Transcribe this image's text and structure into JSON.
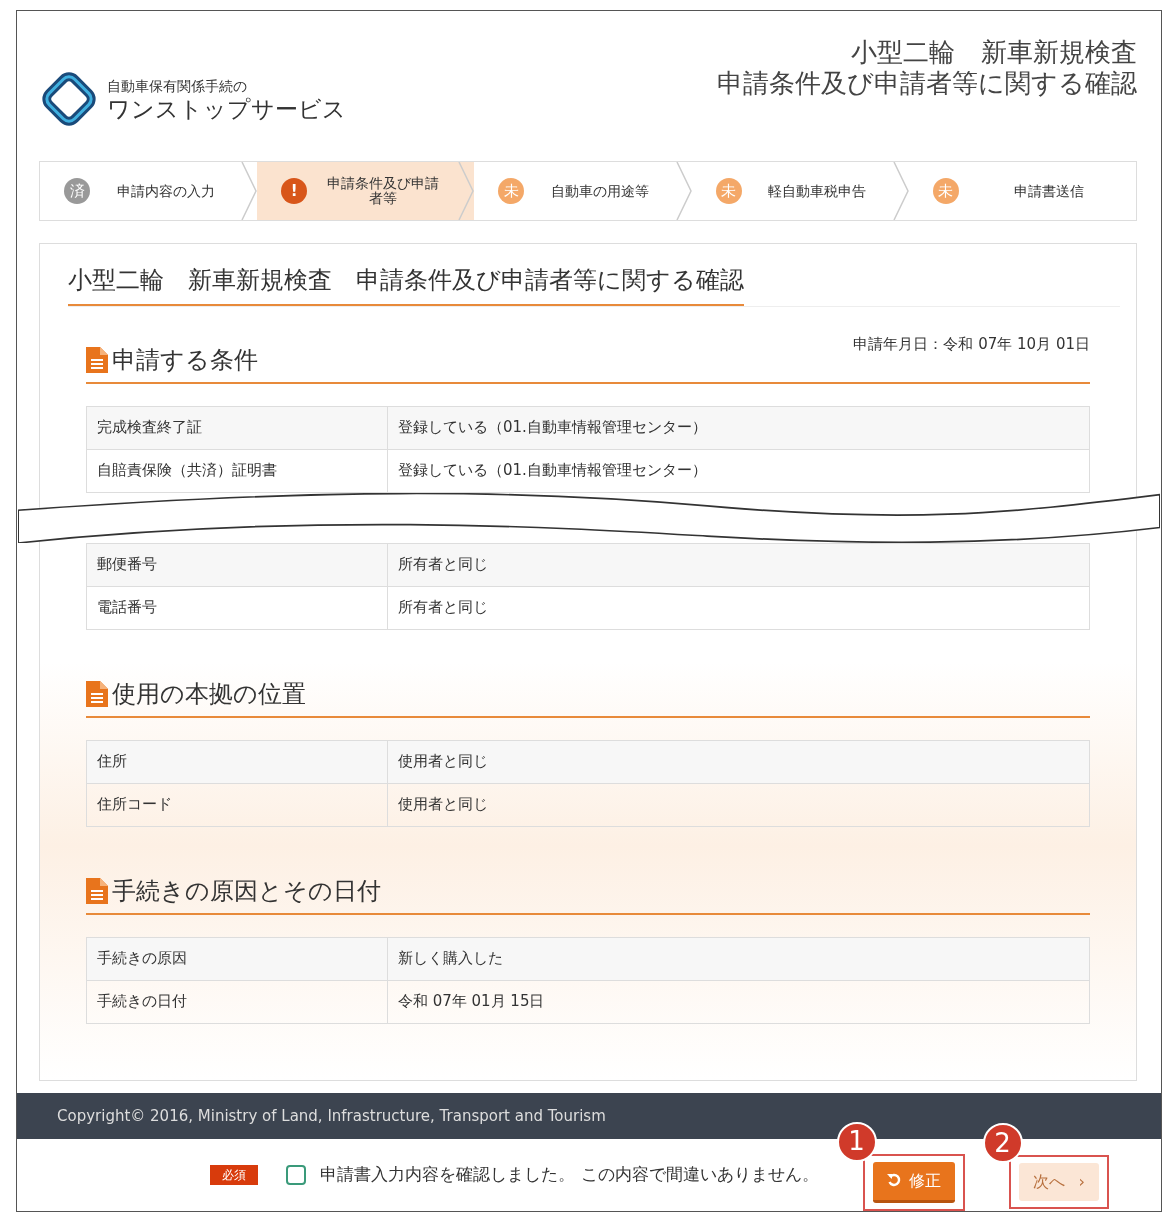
{
  "header": {
    "logo_subtitle": "自動車保有関係手続の",
    "logo_title": "ワンストップサービス",
    "page_title_lines": [
      "小型二輪　新車新規検査",
      "申請条件及び申請者等に関する確認"
    ]
  },
  "steps": [
    {
      "badge": "済",
      "label": "申請内容の入力",
      "kind": "done",
      "selected": false
    },
    {
      "badge": "!",
      "label": "申請条件及び申請者等",
      "kind": "current",
      "selected": true
    },
    {
      "badge": "未",
      "label": "自動車の用途等",
      "kind": "pending",
      "selected": false
    },
    {
      "badge": "未",
      "label": "軽自動車税申告",
      "kind": "pending",
      "selected": false
    },
    {
      "badge": "未",
      "label": "申請書送信",
      "kind": "pending",
      "selected": false
    }
  ],
  "card": {
    "title": "小型二輪　新車新規検査　申請条件及び申請者等に関する確認",
    "date": "申請年月日：令和 07年 10月 01日",
    "sections": [
      {
        "title": "申請する条件",
        "rows": [
          {
            "kind": "row",
            "label": "完成検査終了証",
            "value": "登録している（01.自動車情報管理センター）"
          },
          {
            "kind": "row",
            "label": "自賠責保険（共済）証明書",
            "value": "登録している（01.自動車情報管理センター）"
          },
          {
            "kind": "break"
          },
          {
            "kind": "row",
            "label": "郵便番号",
            "value": "所有者と同じ"
          },
          {
            "kind": "row",
            "label": "電話番号",
            "value": "所有者と同じ"
          }
        ]
      },
      {
        "title": "使用の本拠の位置",
        "rows": [
          {
            "kind": "row",
            "label": "住所",
            "value": "使用者と同じ"
          },
          {
            "kind": "row",
            "label": "住所コード",
            "value": "使用者と同じ"
          }
        ]
      },
      {
        "title": "手続きの原因とその日付",
        "rows": [
          {
            "kind": "row",
            "label": "手続きの原因",
            "value": "新しく購入した"
          },
          {
            "kind": "row",
            "label": "手続きの日付",
            "value": "令和 07年 01月 15日"
          }
        ]
      }
    ]
  },
  "footer": {
    "copyright": "Copyright© 2016, Ministry of Land, Infrastructure, Transport and Tourism"
  },
  "confirm": {
    "required_badge": "必須",
    "checked": false,
    "text": "申請書入力内容を確認しました。 この内容で間違いありません。"
  },
  "buttons": [
    {
      "kind": "fix",
      "label": "修正",
      "callout": "1",
      "disabled": false
    },
    {
      "kind": "next",
      "label": "次へ",
      "suffix": "›",
      "callout": "2",
      "disabled": true
    }
  ]
}
